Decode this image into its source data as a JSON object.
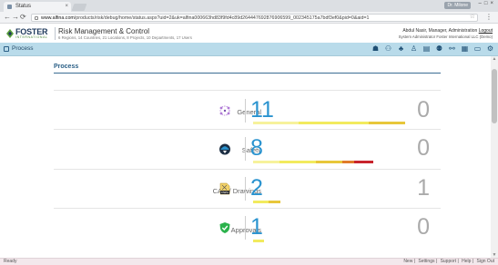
{
  "browser": {
    "tab_title": "Status",
    "user_chip": "Dr. Milone",
    "url_host": "www.alfina.com",
    "url_path": "/products/risk/debug/home/status.aspx?uid=2&uk=alfina000663hd83f9fd4c89d264447692876906599_002345175a7bdf3ef0&pid=0&aid=1"
  },
  "header": {
    "logo_text": "FOSTER",
    "logo_sub": "INTERNATIONAL",
    "app_title": "Risk Management & Control",
    "app_subtitle": "6 Regions, 14 Countries, 21 Locations, 8 Projects, 10 Departments, 17 Users",
    "user_name": "Abdul Nasir, Manager, Administration",
    "logout_label": "Logout",
    "org_line": "System Administrator Foster International LLC (Demo)"
  },
  "toolbar": {
    "label": "Process",
    "icons": [
      "org-chart-icon",
      "users-icon",
      "tree-icon",
      "person-icon",
      "chart-icon",
      "group-icon",
      "network-icon",
      "calendar-icon",
      "monitor-icon",
      "gear-icon"
    ]
  },
  "page": {
    "section_title": "Process",
    "rows": [
      {
        "label": "General",
        "icon": "general-process-icon",
        "count": "11",
        "open": "0",
        "bar": [
          {
            "color": "#f7f29c",
            "share": 0.3
          },
          {
            "color": "#f2ea5e",
            "share": 0.46
          },
          {
            "color": "#e8c73a",
            "share": 0.24
          }
        ]
      },
      {
        "label": "Safety",
        "icon": "safety-helmet-icon",
        "count": "8",
        "open": "0",
        "bar": [
          {
            "color": "#f7f29c",
            "share": 0.22
          },
          {
            "color": "#f2ea5e",
            "share": 0.3
          },
          {
            "color": "#e8c73a",
            "share": 0.22
          },
          {
            "color": "#e07b2a",
            "share": 0.1
          },
          {
            "color": "#c8242c",
            "share": 0.16
          }
        ]
      },
      {
        "label": "CAD / Drawings",
        "icon": "dwg-file-icon",
        "count": "2",
        "open": "1",
        "bar": [
          {
            "color": "#f2ea5e",
            "share": 0.55
          },
          {
            "color": "#e8c73a",
            "share": 0.45
          }
        ]
      },
      {
        "label": "Approvals",
        "icon": "approval-shield-icon",
        "count": "1",
        "open": "0",
        "bar": [
          {
            "color": "#f2ea5e",
            "share": 1.0
          }
        ]
      }
    ]
  },
  "status": {
    "left": "Ready",
    "links": [
      "New",
      "Settings",
      "Support",
      "Help",
      "Sign Out"
    ]
  }
}
